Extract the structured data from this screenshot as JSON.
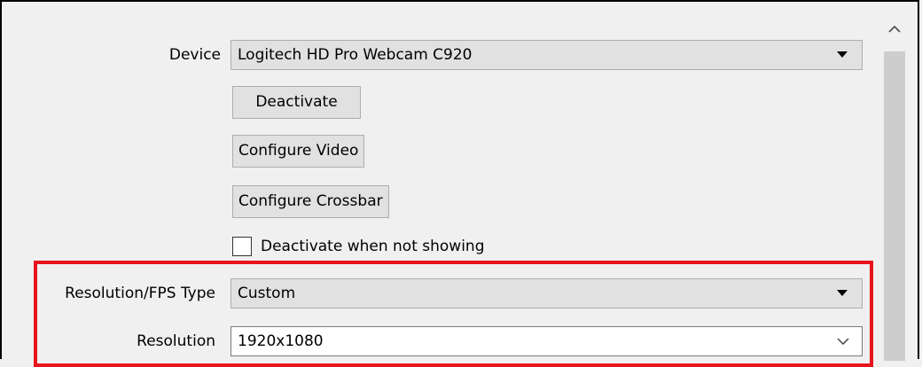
{
  "device": {
    "label": "Device",
    "value": "Logitech HD Pro Webcam C920"
  },
  "buttons": {
    "deactivate": "Deactivate",
    "configure_video": "Configure Video",
    "configure_crossbar": "Configure Crossbar"
  },
  "deactivate_when_not_showing": {
    "label": "Deactivate when not showing",
    "checked": false
  },
  "resolution_fps_type": {
    "label": "Resolution/FPS Type",
    "value": "Custom"
  },
  "resolution": {
    "label": "Resolution",
    "value": "1920x1080"
  },
  "colors": {
    "highlight": "#e8141b"
  },
  "icons": {
    "dropdown": "dropdown-triangle-icon",
    "editable_dropdown": "chevron-down-icon",
    "scroll_up": "chevron-up-icon"
  }
}
